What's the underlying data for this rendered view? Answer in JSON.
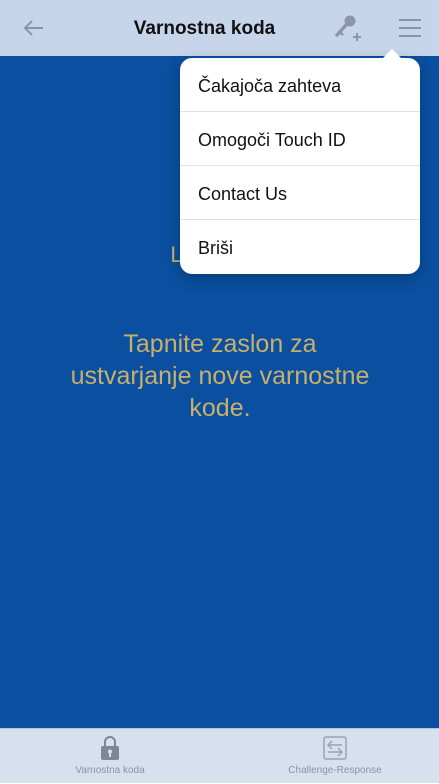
{
  "header": {
    "title": "Varnostna koda",
    "back_icon": "back-arrow-icon",
    "add_key_icon": "key-plus-icon",
    "menu_icon": "hamburger-menu-icon"
  },
  "main": {
    "link_text": "Link",
    "instruction": "Tapnite zaslon za ustvarjanje nove varnostne kode."
  },
  "dropdown": {
    "items": [
      {
        "label": "Čakajoča zahteva"
      },
      {
        "label": "Omogoči Touch ID"
      },
      {
        "label": "Contact Us"
      },
      {
        "label": "Briši"
      }
    ]
  },
  "tabs": [
    {
      "label": "Varnostna koda",
      "icon": "lock-icon"
    },
    {
      "label": "Challenge-Response",
      "icon": "challenge-response-icon"
    }
  ],
  "colors": {
    "header_bg": "#c7d5ea",
    "main_bg": "#0a4fa0",
    "accent_text": "#c9b06a",
    "tabbar_bg": "#d7e0ee"
  }
}
